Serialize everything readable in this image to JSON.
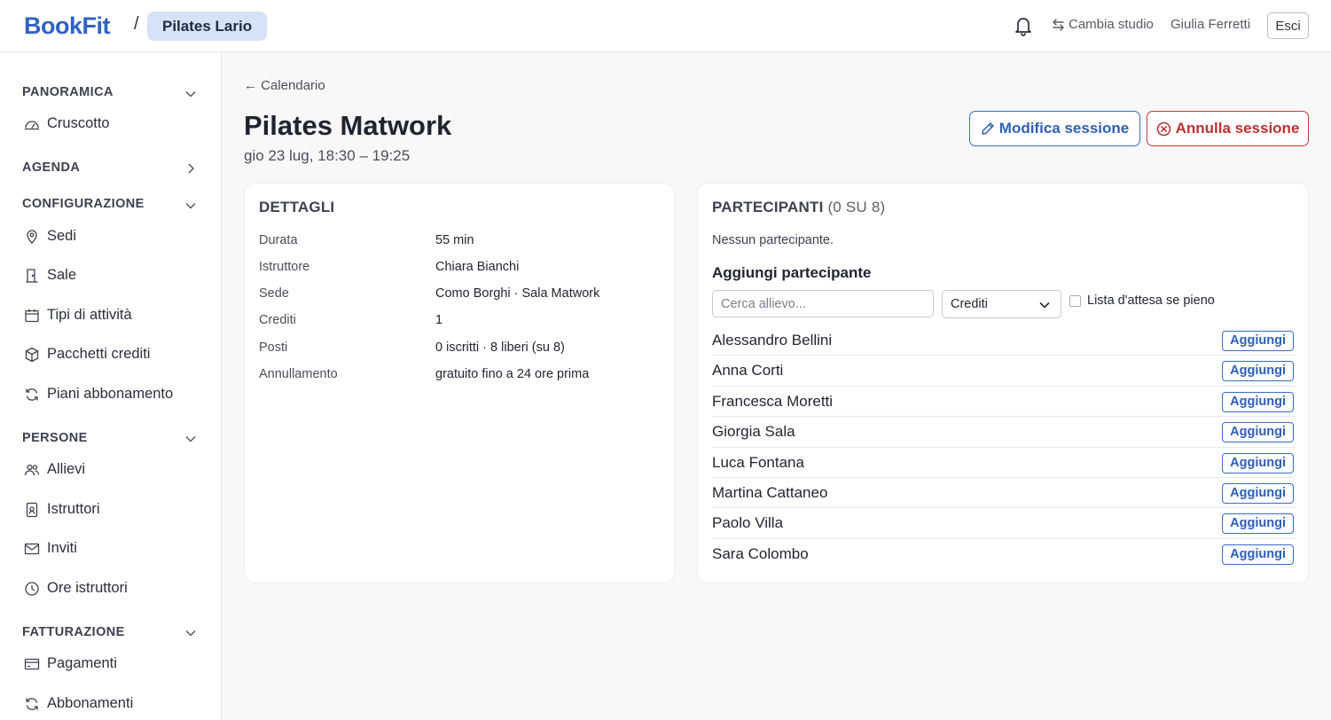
{
  "header": {
    "brand": "BookFit",
    "separator": "/",
    "studio": "Pilates Lario",
    "switch_studio": "Cambia studio",
    "user": "Giulia Ferretti",
    "logout": "Esci"
  },
  "sidebar": {
    "sections": [
      {
        "title": "PANORAMICA",
        "expanded": true,
        "items": [
          "Cruscotto"
        ]
      },
      {
        "title": "AGENDA",
        "expanded": false,
        "items": []
      },
      {
        "title": "CONFIGURAZIONE",
        "expanded": true,
        "items": [
          "Sedi",
          "Sale",
          "Tipi di attività",
          "Pacchetti crediti",
          "Piani abbonamento"
        ]
      },
      {
        "title": "PERSONE",
        "expanded": true,
        "items": [
          "Allievi",
          "Istruttori",
          "Inviti",
          "Ore istruttori"
        ]
      },
      {
        "title": "FATTURAZIONE",
        "expanded": true,
        "items": [
          "Pagamenti",
          "Abbonamenti"
        ]
      }
    ]
  },
  "page": {
    "back": "Calendario",
    "title": "Pilates Matwork",
    "subtitle": "gio 23 lug, 18:30 – 19:25",
    "edit_button": "Modifica sessione",
    "cancel_button": "Annulla sessione"
  },
  "details": {
    "title": "DETTAGLI",
    "rows": [
      {
        "label": "Durata",
        "value": "55 min"
      },
      {
        "label": "Istruttore",
        "value": "Chiara Bianchi"
      },
      {
        "label": "Sede",
        "value": "Como Borghi · Sala Matwork"
      },
      {
        "label": "Crediti",
        "value": "1"
      },
      {
        "label": "Posti",
        "value": "0 iscritti · 8 liberi (su 8)"
      },
      {
        "label": "Annullamento",
        "value": "gratuito fino a 24 ore prima"
      }
    ]
  },
  "participants": {
    "title": "PARTECIPANTI",
    "count": "(0 SU 8)",
    "empty": "Nessun partecipante.",
    "add_title": "Aggiungi partecipante",
    "search_placeholder": "Cerca allievo...",
    "select_value": "Crediti",
    "waitlist_label": "Lista d'attesa se pieno",
    "add_label": "Aggiungi",
    "people": [
      "Alessandro Bellini",
      "Anna Corti",
      "Francesca Moretti",
      "Giorgia Sala",
      "Luca Fontana",
      "Martina Cattaneo",
      "Paolo Villa",
      "Sara Colombo"
    ]
  },
  "colors": {
    "accent": "#2f63c4",
    "danger": "#c03030",
    "pill": "#d6e2f7"
  }
}
